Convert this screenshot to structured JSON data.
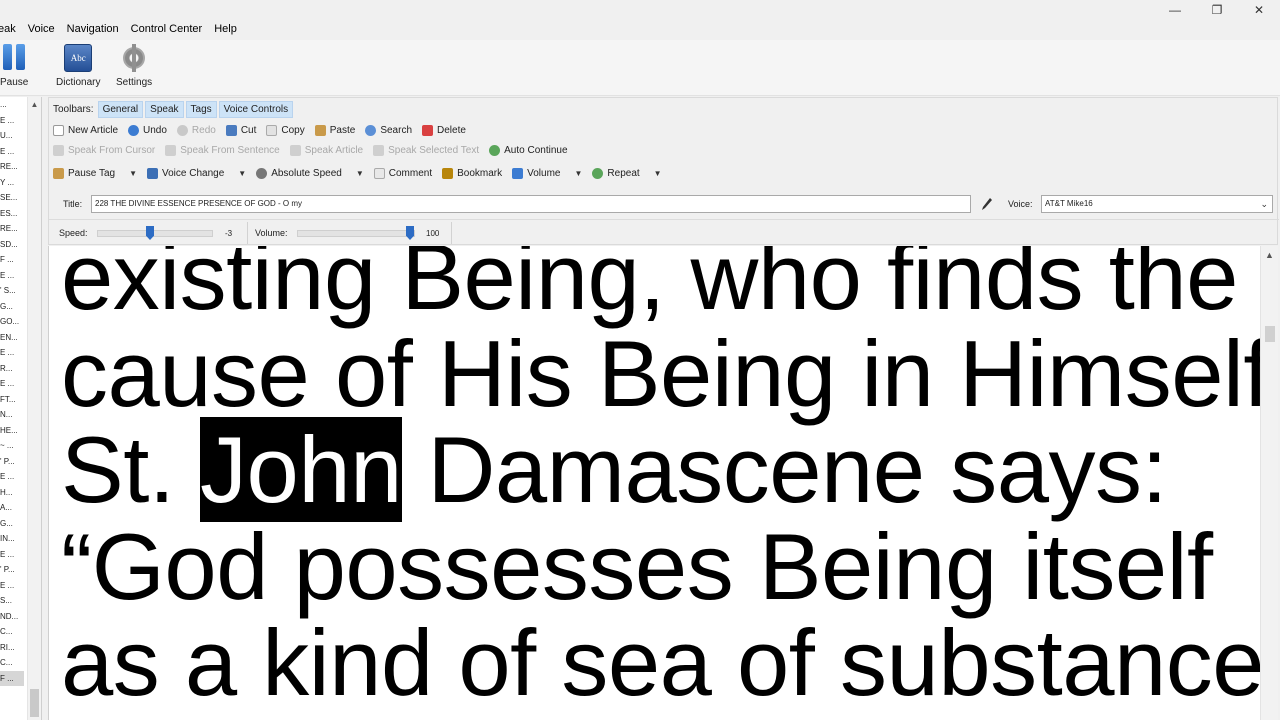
{
  "menu": [
    "eak",
    "Voice",
    "Navigation",
    "Control Center",
    "Help"
  ],
  "window_controls": {
    "minimize": "—",
    "restore": "❐",
    "close": "✕"
  },
  "big_toolbar": {
    "pause": "Pause",
    "dictionary": "Dictionary",
    "dictionary_icon_text": "Abc",
    "settings": "Settings"
  },
  "tree_items": [
    "...",
    "E ...",
    "U...",
    "E ...",
    "RE...",
    "Y ...",
    "SE...",
    "ES...",
    "RE...",
    "SD...",
    "F ...",
    "E ...",
    "' S...",
    "G...",
    "GO...",
    "EN...",
    "E ...",
    "R...",
    "E ...",
    "FT...",
    "N...",
    "HE...",
    "~ ...",
    "' P...",
    "E ...",
    "H...",
    "A...",
    "G...",
    "IN...",
    "E ...",
    "' P...",
    "E ...",
    "S...",
    "ND...",
    "C...",
    "RI...",
    "C...",
    "F ..."
  ],
  "toolbars": {
    "label": "Toolbars:",
    "tabs": [
      "General",
      "Speak",
      "Tags",
      "Voice Controls"
    ],
    "row1": [
      "New Article",
      "Undo",
      "Redo",
      "Cut",
      "Copy",
      "Paste",
      "Search",
      "Delete"
    ],
    "row2": [
      "Speak From Cursor",
      "Speak From Sentence",
      "Speak Article",
      "Speak Selected Text",
      "Auto Continue"
    ],
    "row3": [
      "Pause Tag",
      "Voice Change",
      "Absolute Speed",
      "Comment",
      "Bookmark",
      "Volume",
      "Repeat"
    ]
  },
  "title_field": {
    "label": "Title:",
    "value": "228 THE DIVINE ESSENCE PRESENCE OF GOD - O my"
  },
  "voice_field": {
    "label": "Voice:",
    "value": "AT&T Mike16"
  },
  "speed": {
    "label": "Speed:",
    "value": "-3",
    "level": 0.45
  },
  "volume": {
    "label": "Volume:",
    "value": "100",
    "level": 1.0
  },
  "document": {
    "line1": "existing Being, who finds the",
    "line2": "cause of His Being in Himself.",
    "line3_pre": "St. ",
    "line3_hl": "John",
    "line3_post": " Damascene says:",
    "line4": "“God possesses Being itself",
    "line5": "as a kind of sea of substance,"
  },
  "colors": {
    "highlight_bg": "#000000",
    "tab_bg": "#cde3f7",
    "accent": "#2d6cc4"
  }
}
